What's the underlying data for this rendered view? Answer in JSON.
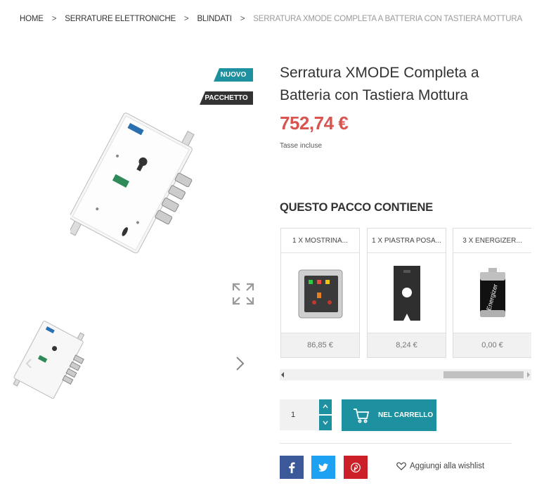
{
  "breadcrumb": {
    "items": [
      "HOME",
      "SERRATURE ELETTRONICHE",
      "BLINDATI"
    ],
    "current": "SERRATURA XMODE COMPLETA A BATTERIA CON TASTIERA MOTTURA",
    "separator": ">"
  },
  "badges": {
    "new": "NUOVO",
    "pack": "PACCHETTO"
  },
  "product": {
    "title": "Serratura XMODE Completa a Batteria con Tastiera Mottura",
    "price": "752,74 €",
    "tax_note": "Tasse incluse"
  },
  "pack": {
    "heading": "QUESTO PACCO CONTIENE",
    "items": [
      {
        "name": "1 X MOSTRINA...",
        "price": "86,85 €"
      },
      {
        "name": "1 X PIASTRA POSA...",
        "price": "8,24 €"
      },
      {
        "name": "3 X ENERGIZER...",
        "price": "0,00 €"
      }
    ]
  },
  "cart": {
    "quantity": "1",
    "button_label": "NEL CARRELLO"
  },
  "wishlist": {
    "label": "Aggiungi alla wishlist"
  },
  "colors": {
    "accent": "#1d919f",
    "price": "#d9534f",
    "facebook": "#3b5998",
    "twitter": "#1da1f2",
    "pinterest": "#cb2027"
  }
}
